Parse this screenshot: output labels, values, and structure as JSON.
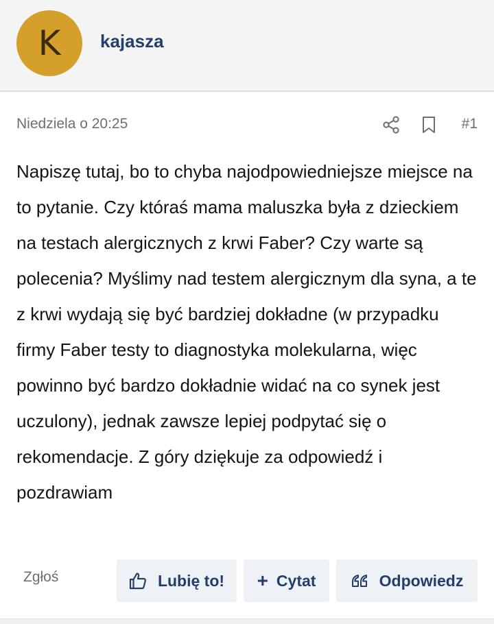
{
  "user": {
    "avatar_letter": "K",
    "name": "kajasza"
  },
  "post": {
    "date": "Niedziela o 20:25",
    "number": "#1",
    "body": "Napiszę tutaj, bo to chyba najodpowiedniejsze miejsce na to pytanie. Czy któraś mama maluszka była z dzieckiem na testach alergicznych z krwi Faber? Czy warte są polecenia? Myślimy nad testem alergicznym dla syna, a te z krwi wydają się być bardziej dokładne (w przypadku firmy Faber testy to diagnostyka molekularna, więc powinno być bardzo dokładnie widać na co synek jest uczulony), jednak zawsze lepiej podpytać się o rekomendacje. Z góry dziękuje za odpowiedź i pozdrawiam"
  },
  "actions": {
    "report": "Zgłoś",
    "like": "Lubię to!",
    "quote_symbol": "+",
    "quote": "Cytat",
    "reply": "Odpowiedz"
  },
  "icons": {
    "share": "share-icon",
    "bookmark": "bookmark-icon",
    "like": "thumbs-up-icon",
    "reply": "quote-marks-icon"
  },
  "colors": {
    "avatar": "#d49f2b",
    "username": "#223e6b",
    "button_bg": "#eef1f6",
    "button_text": "#223e6b",
    "meta_text": "#6e6e6e",
    "header_bg": "#f4f4f4"
  }
}
